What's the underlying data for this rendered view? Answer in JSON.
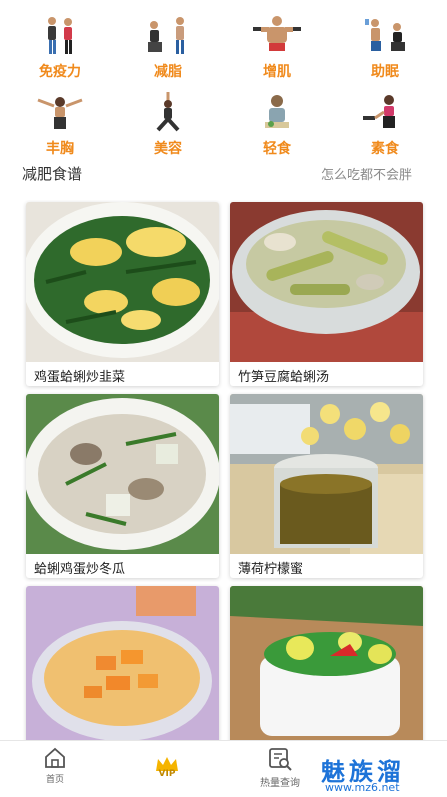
{
  "categories": [
    {
      "label": "免疫力",
      "icon": "fitness-couple-icon"
    },
    {
      "label": "减脂",
      "icon": "fitness-couple-icon"
    },
    {
      "label": "增肌",
      "icon": "muscle-man-icon"
    },
    {
      "label": "助眠",
      "icon": "fitness-couple-icon"
    },
    {
      "label": "丰胸",
      "icon": "woman-stretching-icon"
    },
    {
      "label": "美容",
      "icon": "yoga-pose-icon"
    },
    {
      "label": "轻食",
      "icon": "woman-eating-icon"
    },
    {
      "label": "素食",
      "icon": "woman-dumbbell-icon"
    }
  ],
  "section": {
    "title": "减肥食谱",
    "subtitle": "怎么吃都不会胖"
  },
  "recipes": [
    {
      "name": "鸡蛋蛤蜊炒韭菜",
      "photo": "egg-chive-dish"
    },
    {
      "name": "竹笋豆腐蛤蜊汤",
      "photo": "bamboo-clam-soup"
    },
    {
      "name": "蛤蜊鸡蛋炒冬瓜",
      "photo": "clam-wintermelon-dish"
    },
    {
      "name": "薄荷柠檬蜜",
      "photo": "mint-lemon-honey-drink"
    },
    {
      "name": "",
      "photo": "mango-sago-dessert"
    },
    {
      "name": "",
      "photo": "green-vegetable-salad"
    }
  ],
  "tabbar": {
    "home": "首页",
    "vip": "VIP",
    "calorie": "热量查询"
  },
  "watermark": {
    "name": "魅族溜",
    "url": "www.mz6.net"
  },
  "colors": {
    "category_label": "#f08a1c",
    "watermark": "#1d73d8",
    "vip_crown": "#f5b400"
  }
}
